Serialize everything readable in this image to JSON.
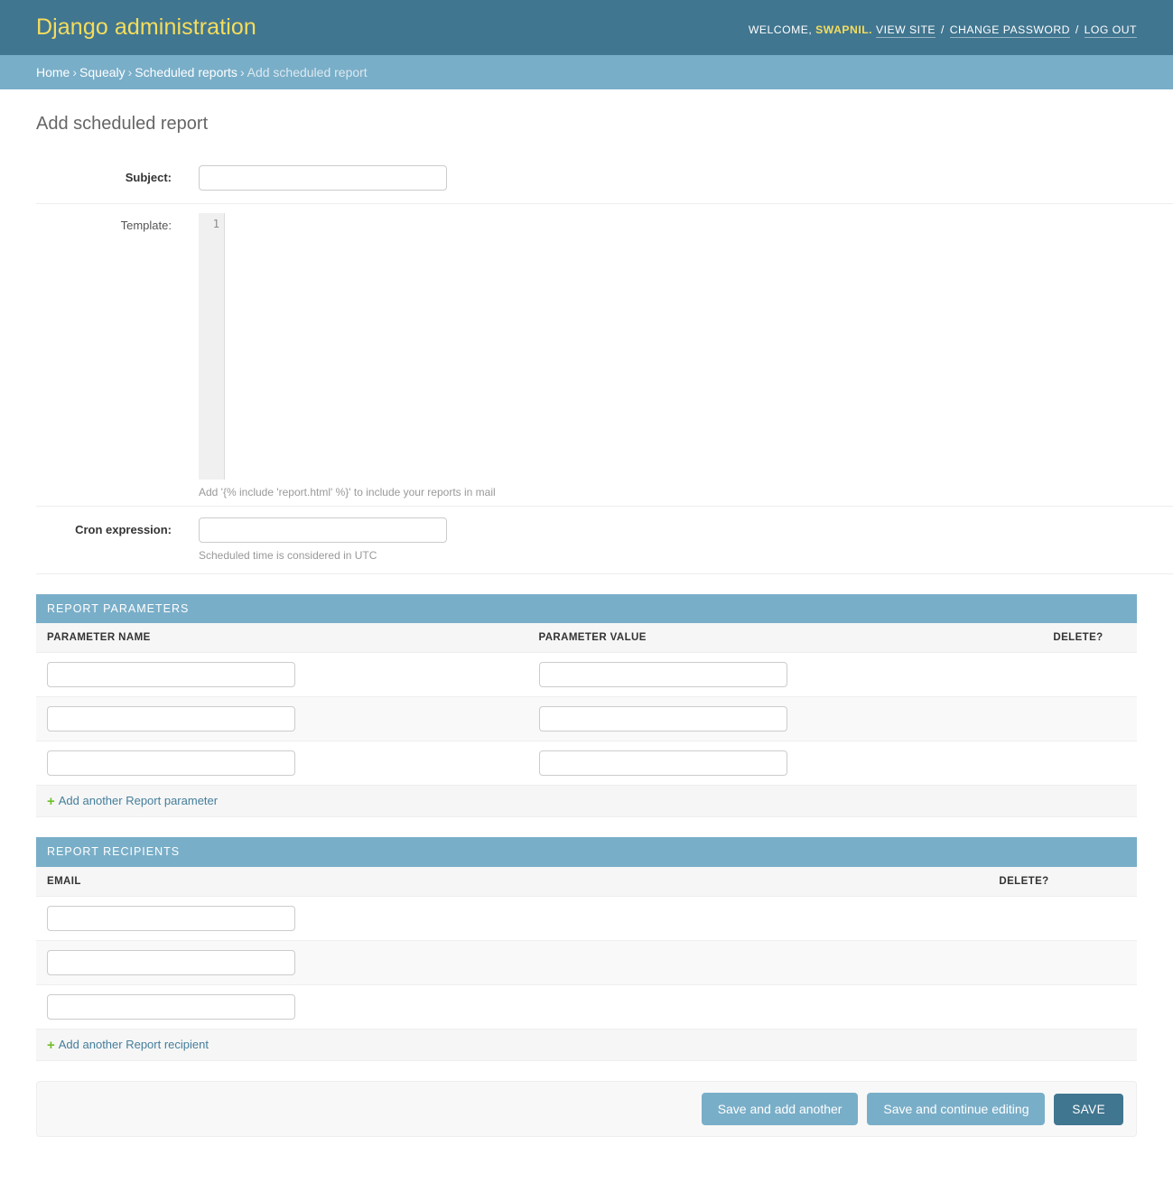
{
  "header": {
    "site_title": "Django administration",
    "welcome_prefix": "WELCOME,",
    "username": "SWAPNIL.",
    "view_site": "VIEW SITE",
    "change_password": "CHANGE PASSWORD",
    "log_out": "LOG OUT",
    "separator": "/"
  },
  "breadcrumbs": {
    "home": "Home",
    "app": "Squealy",
    "model": "Scheduled reports",
    "current": "Add scheduled report",
    "separator": "›"
  },
  "page": {
    "title": "Add scheduled report"
  },
  "form": {
    "subject": {
      "label": "Subject:",
      "value": "",
      "placeholder": ""
    },
    "template": {
      "label": "Template:",
      "line_number": "1",
      "code": "",
      "help": "Add '{% include 'report.html' %}' to include your reports in mail"
    },
    "cron": {
      "label": "Cron expression:",
      "value": "",
      "placeholder": "",
      "help": "Scheduled time is considered in UTC"
    }
  },
  "report_parameters": {
    "heading": "REPORT PARAMETERS",
    "columns": [
      "PARAMETER NAME",
      "PARAMETER VALUE",
      "DELETE?"
    ],
    "rows": [
      {
        "name": "",
        "value": ""
      },
      {
        "name": "",
        "value": ""
      },
      {
        "name": "",
        "value": ""
      }
    ],
    "add_label": "Add another Report parameter",
    "add_icon": "plus-icon",
    "add_icon_glyph": "+"
  },
  "report_recipients": {
    "heading": "REPORT RECIPIENTS",
    "columns": [
      "EMAIL",
      "DELETE?"
    ],
    "rows": [
      {
        "email": ""
      },
      {
        "email": ""
      },
      {
        "email": ""
      }
    ],
    "add_label": "Add another Report recipient",
    "add_icon": "plus-icon",
    "add_icon_glyph": "+"
  },
  "submit_row": {
    "save_and_add_another": "Save and add another",
    "save_and_continue": "Save and continue editing",
    "save": "SAVE"
  },
  "colors": {
    "header_bg": "#417690",
    "breadcrumb_bg": "#79aec8",
    "brand_text": "#f5dd5d",
    "link": "#447e9b",
    "add_icon": "#70bf2b",
    "row_alt": "#f9f9f9",
    "save_default_bg": "#417690",
    "save_bg": "#79aec8"
  }
}
